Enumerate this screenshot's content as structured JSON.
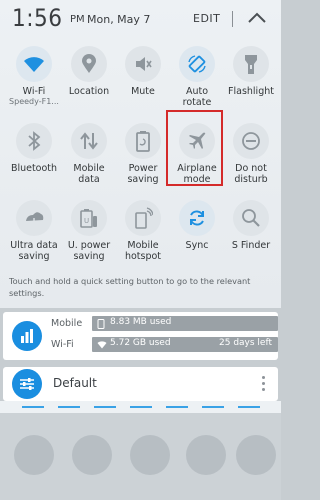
{
  "status": {
    "time": "1:56",
    "ampm": "PM",
    "date": "Mon, May 7",
    "edit_label": "EDIT"
  },
  "tiles": [
    {
      "label": "Wi-Fi",
      "sub": "Speedy-F1...",
      "icon": "wifi-icon"
    },
    {
      "label": "Location",
      "icon": "location-icon"
    },
    {
      "label": "Mute",
      "icon": "mute-icon"
    },
    {
      "label": "Auto",
      "label2": "rotate",
      "icon": "auto-rotate-icon"
    },
    {
      "label": "Flashlight",
      "icon": "flashlight-icon"
    },
    {
      "label": "Bluetooth",
      "icon": "bluetooth-icon"
    },
    {
      "label": "Mobile",
      "label2": "data",
      "icon": "mobile-data-icon"
    },
    {
      "label": "Power",
      "label2": "saving",
      "icon": "power-saving-icon"
    },
    {
      "label": "Airplane",
      "label2": "mode",
      "icon": "airplane-icon"
    },
    {
      "label": "Do not",
      "label2": "disturb",
      "icon": "do-not-disturb-icon"
    },
    {
      "label": "Ultra data",
      "label2": "saving",
      "icon": "ultra-data-saving-icon"
    },
    {
      "label": "U. power",
      "label2": "saving",
      "icon": "ultra-power-saving-icon"
    },
    {
      "label": "Mobile",
      "label2": "hotspot",
      "icon": "hotspot-icon"
    },
    {
      "label": "Sync",
      "icon": "sync-icon"
    },
    {
      "label": "S Finder",
      "icon": "s-finder-icon"
    }
  ],
  "hint": "Touch and hold a quick setting button to go to the relevant settings.",
  "data_usage": {
    "mobile_label": "Mobile",
    "mobile_value": "8.83 MB used",
    "wifi_label": "Wi-Fi",
    "wifi_value": "5.72 GB used",
    "wifi_days": "25 days left"
  },
  "profile": {
    "name": "Default"
  },
  "colors": {
    "accent": "#1a8ee0",
    "highlight": "#d42a2a"
  }
}
